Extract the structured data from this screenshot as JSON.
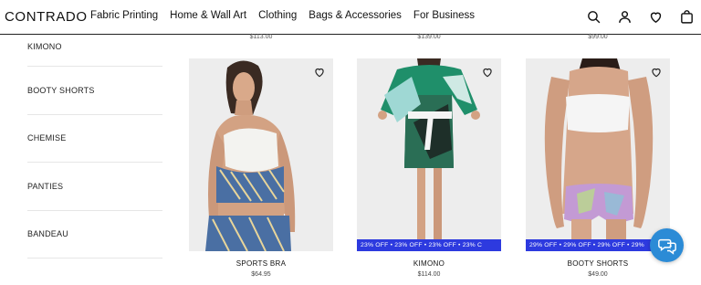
{
  "brand": {
    "logo": "CONTRADO"
  },
  "nav": {
    "items": [
      "Fabric Printing",
      "Home & Wall Art",
      "Clothing",
      "Bags & Accessories",
      "For Business"
    ]
  },
  "header_icons": [
    "search-icon",
    "user-icon",
    "heart-icon",
    "shopping-bag-icon"
  ],
  "top_prices": [
    "$113.00",
    "$139.00",
    "$99.00"
  ],
  "sidebar": {
    "items": [
      "KIMONO",
      "BOOTY SHORTS",
      "CHEMISE",
      "PANTIES",
      "BANDEAU"
    ]
  },
  "products": [
    {
      "name": "SPORTS BRA",
      "price": "$64.95",
      "promo": ""
    },
    {
      "name": "KIMONO",
      "price": "$114.00",
      "promo": "23% OFF  •  23% OFF  •  23% OFF  •  23% C"
    },
    {
      "name": "BOOTY SHORTS",
      "price": "$49.00",
      "promo": "29% OFF  •  29% OFF  •  29% OFF  •  29%"
    }
  ],
  "colors": {
    "promo": "#2d3adf",
    "chat": "#2b8bd6",
    "image_bg": "#ededed"
  },
  "chat_icon": "chat-help-icon"
}
